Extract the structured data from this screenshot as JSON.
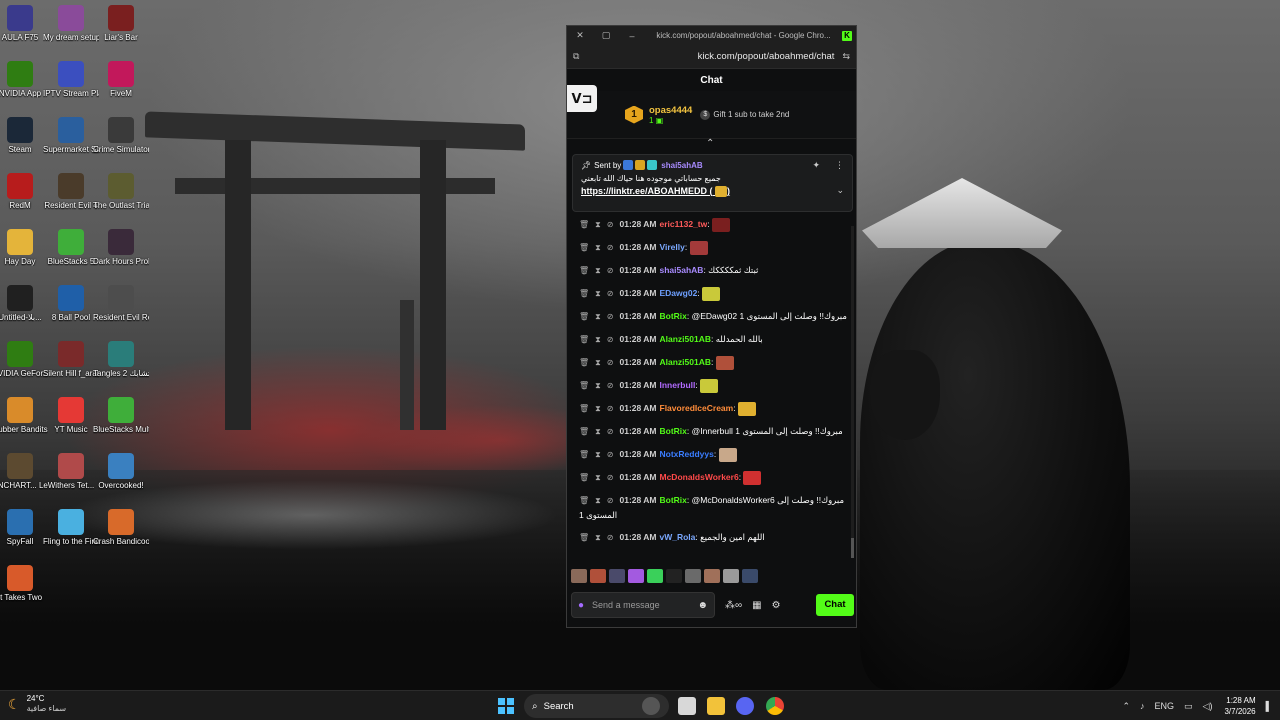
{
  "desktop_icons": [
    {
      "label": "AULA F75",
      "color": "#3a3a8c"
    },
    {
      "label": "My dream setup",
      "color": "#8a4b9a"
    },
    {
      "label": "Liar's Bar",
      "color": "#7a1f1f"
    },
    {
      "label": "NVIDIA App",
      "color": "#2f7d12"
    },
    {
      "label": "IPTV Stream Player",
      "color": "#3b4fbf"
    },
    {
      "label": "FiveM",
      "color": "#c2185b"
    },
    {
      "label": "Steam",
      "color": "#1b2838"
    },
    {
      "label": "Supermarket Simulator",
      "color": "#2a5f9e"
    },
    {
      "label": "Crime Simulator",
      "color": "#3a3a3a"
    },
    {
      "label": "RedM",
      "color": "#b71c1c"
    },
    {
      "label": "Resident Evil 4",
      "color": "#4a3b2a"
    },
    {
      "label": "The Outlast Trials",
      "color": "#5c5c30"
    },
    {
      "label": "Hay Day",
      "color": "#e4b43a"
    },
    {
      "label": "BlueStacks 5",
      "color": "#3fae3a"
    },
    {
      "label": "Dark Hours Prologue",
      "color": "#3a2a3a"
    },
    {
      "label": "Untitled-بلا...",
      "color": "#202020"
    },
    {
      "label": "8 Ball Pool",
      "color": "#1f5fa8"
    },
    {
      "label": "Resident Evil Requiem",
      "color": "#4d4d4d"
    },
    {
      "label": "NVIDIA GeFor...",
      "color": "#2f7d12"
    },
    {
      "label": "Silent Hill f_arabic.exe",
      "color": "#7a2a2a"
    },
    {
      "label": "Tangles 2 تشابك Demo",
      "color": "#2a7d7a"
    },
    {
      "label": "Rubber Bandits",
      "color": "#d98b2a"
    },
    {
      "label": "YT Music",
      "color": "#e53935"
    },
    {
      "label": "BlueStacks Multi-Insta...",
      "color": "#3fae3a"
    },
    {
      "label": "UNCHART... Legacy of ...",
      "color": "#5c4a30"
    },
    {
      "label": "Withers Tet...",
      "color": "#b04a4a"
    },
    {
      "label": "Overcooked!",
      "color": "#3a80c0"
    },
    {
      "label": "SpyFall",
      "color": "#2a6fb0"
    },
    {
      "label": "Fling to the Finish",
      "color": "#4ab0e0"
    },
    {
      "label": "Crash Bandicoot...",
      "color": "#d86a2a"
    },
    {
      "label": "It Takes Two",
      "color": "#d85a2a"
    }
  ],
  "browser": {
    "window_title": "kick.com/popout/aboahmed/chat - Google Chro...",
    "url": "kick.com/popout/aboahmed/chat",
    "minimize": "–",
    "restore": "▢",
    "close": "✕"
  },
  "chat": {
    "header": "Chat",
    "side_logo": "ᐯ⊐",
    "leaderboard": {
      "rank": "1",
      "name": "opas4444",
      "count": "1",
      "gift_text": "Gift 1 sub to take 2nd"
    },
    "pinned": {
      "sent_by_label": "Sent by",
      "user": "shai5ahAB",
      "message": "جميع حساباتي موجوده هنا حياك الله تابعني",
      "link": "https://linktr.ee/ABOAHMEDD (",
      "link_tail": ")"
    },
    "messages": [
      {
        "time": "01:28 AM",
        "user": "eric1132_tw",
        "color": "#ff5a5a",
        "text": "",
        "emote": "#7a1f1f"
      },
      {
        "time": "01:28 AM",
        "user": "Virelly",
        "color": "#7aa8ff",
        "text": "",
        "emote": "#a33a3a"
      },
      {
        "time": "01:28 AM",
        "user": "shai5ahAB",
        "color": "#a88bff",
        "text": "ثبتك ثمككككك",
        "emote": ""
      },
      {
        "time": "01:28 AM",
        "user": "EDawg02",
        "color": "#6ea0ff",
        "text": "",
        "emote": "#c9c93a"
      },
      {
        "time": "01:28 AM",
        "user": "BotRix",
        "color": "#53fc18",
        "text": "@EDawg02 مبروك!! وصلت إلى المستوى 1",
        "emote": ""
      },
      {
        "time": "01:28 AM",
        "user": "Alanzi501AB",
        "color": "#53fc18",
        "text": "بالله الحمدلله",
        "emote": ""
      },
      {
        "time": "01:28 AM",
        "user": "Alanzi501AB",
        "color": "#53fc18",
        "text": "",
        "emote": "#b0503a"
      },
      {
        "time": "01:28 AM",
        "user": "Innerbull",
        "color": "#b26bff",
        "text": "",
        "emote": "#c9c93a"
      },
      {
        "time": "01:28 AM",
        "user": "FlavoredIceCream",
        "color": "#ff8c3a",
        "text": "",
        "emote": "#e0b030"
      },
      {
        "time": "01:28 AM",
        "user": "BotRix",
        "color": "#53fc18",
        "text": "@Innerbull مبروك!! وصلت إلى المستوى 1",
        "emote": ""
      },
      {
        "time": "01:28 AM",
        "user": "NotxReddyys",
        "color": "#3a7dff",
        "text": "",
        "emote": "#c8a88a"
      },
      {
        "time": "01:28 AM",
        "user": "McDonaldsWorker6",
        "color": "#ff4a4a",
        "text": "",
        "emote": "#d03030"
      },
      {
        "time": "01:28 AM",
        "user": "BotRix",
        "color": "#53fc18",
        "text": "@McDonaldsWorker6 مبروك!! وصلت إلى المستوى 1",
        "emote": ""
      },
      {
        "time": "01:28 AM",
        "user": "vW_Rola",
        "color": "#7aa8ff",
        "text": "اللهم امين والجميع",
        "emote": ""
      }
    ],
    "input_placeholder": "Send a message",
    "send_label": "Chat"
  },
  "taskbar": {
    "temperature": "24°C",
    "weather_desc": "سماء صافية",
    "search_label": "Search",
    "language": "ENG",
    "time": "1:28 AM",
    "date": "3/7/2026"
  }
}
